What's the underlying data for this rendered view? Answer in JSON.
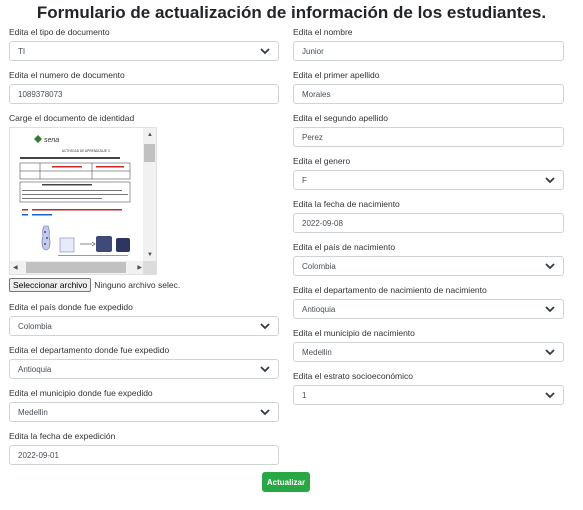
{
  "title": "Formulario de actualización de información de los estudiantes.",
  "left": {
    "doc_type": {
      "label": "Edita el tipo de documento",
      "value": "TI"
    },
    "doc_number": {
      "label": "Edita el numero de documento",
      "value": "1089378073"
    },
    "doc_upload": {
      "label": "Carge el documento de identidad",
      "button_label": "Seleccionar archivo",
      "status": "Ninguno archivo selec."
    },
    "issue_country": {
      "label": "Edita el país donde fue expedido",
      "value": "Colombia"
    },
    "issue_department": {
      "label": "Edita el departamento donde fue expedido",
      "value": "Antioquia"
    },
    "issue_municipality": {
      "label": "Edita el municipio donde fue expedido",
      "value": "Medellin"
    },
    "issue_date": {
      "label": "Edita la fecha de expedición",
      "value": "2022-09-01"
    }
  },
  "right": {
    "first_name": {
      "label": "Edita el nombre",
      "value": "Junior"
    },
    "last_name_1": {
      "label": "Edita el primer apellido",
      "value": "Morales"
    },
    "last_name_2": {
      "label": "Edita el segundo apellido",
      "value": "Perez"
    },
    "gender": {
      "label": "Edita el genero",
      "value": "F"
    },
    "birth_date": {
      "label": "Edita la fecha de nacimiento",
      "value": "2022-09-08"
    },
    "birth_country": {
      "label": "Edita el país de nacimiento",
      "value": "Colombia"
    },
    "birth_department": {
      "label": "Edita el departamento de nacimiento de nacimiento",
      "value": "Antioquia"
    },
    "birth_municipality": {
      "label": "Edita el municipio de nacimiento",
      "value": "Medellin"
    },
    "socio_stratum": {
      "label": "Edita el estrato socioeconómico",
      "value": "1"
    }
  },
  "submit_label": "Actualizar",
  "preview": {
    "logo_text": "sena",
    "subtitle": "ACTIVIDAD DE APRENDIZAJE 3"
  }
}
